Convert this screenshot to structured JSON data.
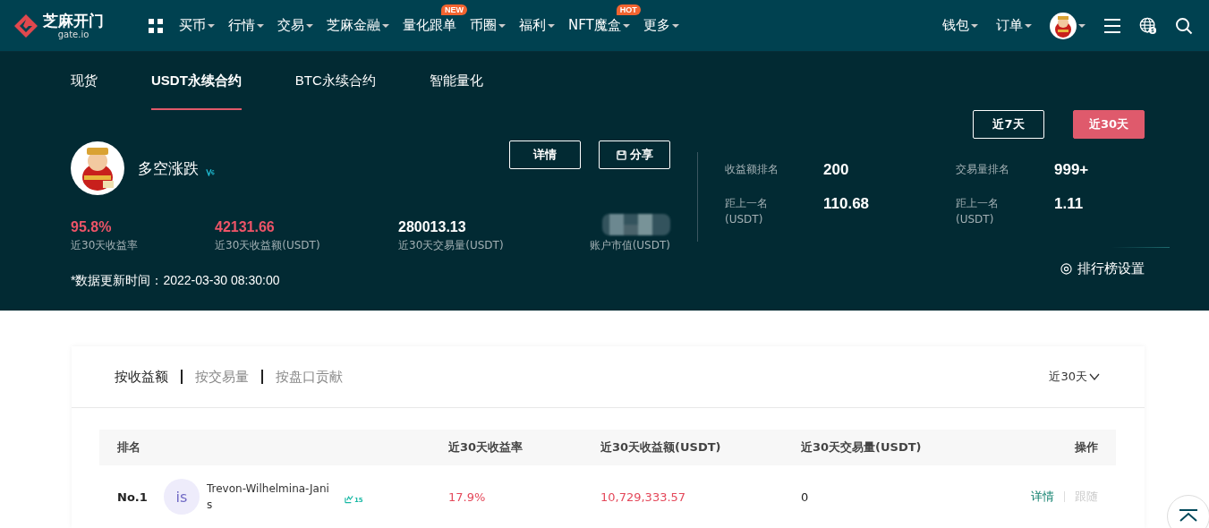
{
  "nav": {
    "logo": {
      "name": "芝麻开门",
      "sub": "gate.io"
    },
    "items": [
      {
        "label": "买币",
        "dropdown": true
      },
      {
        "label": "行情",
        "dropdown": true
      },
      {
        "label": "交易",
        "dropdown": true
      },
      {
        "label": "芝麻金融",
        "dropdown": true
      },
      {
        "label": "量化跟单",
        "dropdown": false,
        "badge": "NEW"
      },
      {
        "label": "币圈",
        "dropdown": true
      },
      {
        "label": "福利",
        "dropdown": true
      },
      {
        "label": "NFT魔盒",
        "dropdown": true,
        "badge": "HOT"
      },
      {
        "label": "更多",
        "dropdown": true
      }
    ],
    "right_items": [
      {
        "label": "钱包"
      },
      {
        "label": "订单"
      }
    ]
  },
  "tabs": [
    {
      "label": "现货",
      "selected": false
    },
    {
      "label": "USDT永续合约",
      "selected": true
    },
    {
      "label": "BTC永续合约",
      "selected": false
    },
    {
      "label": "智能量化",
      "selected": false
    }
  ],
  "periods": [
    {
      "label": "近7天",
      "selected": false
    },
    {
      "label": "近30天",
      "selected": true
    }
  ],
  "profile": {
    "name": "多空涨跌",
    "buttons": [
      {
        "label": "详情",
        "kind": "plain"
      },
      {
        "label": "分享",
        "kind": "share"
      }
    ]
  },
  "stats": [
    {
      "value": "95.8%",
      "label": "近30天收益率",
      "kind": "red"
    },
    {
      "value": "42131.66",
      "label": "近30天收益额(USDT)",
      "kind": "red"
    },
    {
      "value": "280013.13",
      "label": "近30天交易量(USDT)",
      "kind": "white"
    },
    {
      "label": "账户市值(USDT)",
      "kind": "masked"
    }
  ],
  "ranks": [
    {
      "label": "收益额排名",
      "value": "200"
    },
    {
      "label": "交易量排名",
      "value": "999+"
    },
    {
      "label": "距上一名",
      "unit": "(USDT)",
      "value": "110.68"
    },
    {
      "label": "距上一名",
      "unit": "(USDT)",
      "value": "1.11"
    }
  ],
  "update_time": "*数据更新时间：2022-03-30 08:30:00",
  "settings_link": "排行榜设置",
  "rank_tabs": [
    {
      "label": "按收益额",
      "selected": true
    },
    {
      "label": "按交易量",
      "selected": false
    },
    {
      "label": "按盘口贡献",
      "selected": false
    }
  ],
  "period_select": "近30天",
  "table": {
    "columns": [
      "排名",
      "近30天收益率",
      "近30天收益额(USDT)",
      "近30天交易量(USDT)",
      "操作"
    ],
    "rows": [
      {
        "rank": "No.1",
        "initials": "is",
        "name": "Trevon-Wilhelmina-Janis",
        "level": "15",
        "rate": "17.9%",
        "profit": "10,729,333.57",
        "volume": "0",
        "actions": [
          {
            "label": "详情",
            "disabled": false
          },
          {
            "label": "跟随",
            "disabled": true
          }
        ]
      }
    ]
  }
}
